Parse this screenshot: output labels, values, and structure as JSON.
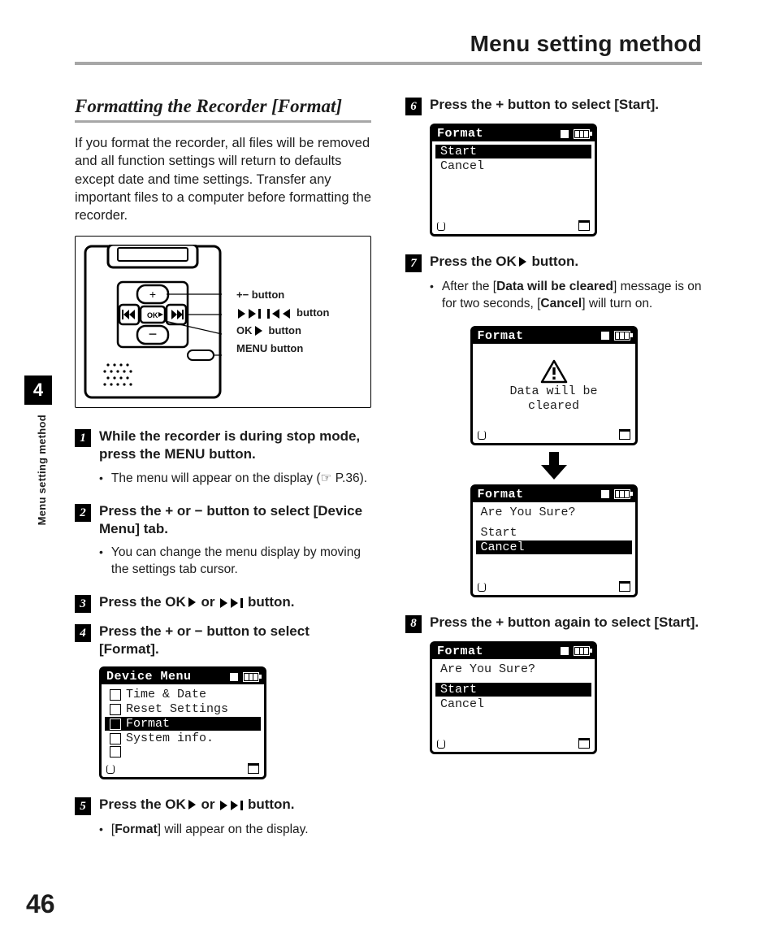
{
  "header": {
    "title": "Menu setting method"
  },
  "side": {
    "chapter": "4",
    "label": "Menu setting method"
  },
  "pagenum": "46",
  "section_title": "Formatting the Recorder [Format]",
  "intro": "If you format the recorder, all files will be removed and all function settings will return to defaults except date and time settings. Transfer any important files to a computer before formatting the recorder.",
  "legend": {
    "pm": "+− button",
    "skip": " button",
    "ok": " button",
    "menu": "MENU button"
  },
  "steps": {
    "s1": {
      "n": "1",
      "text_a": "While the recorder is during stop mode, press the ",
      "text_b": "MENU",
      "text_c": " button."
    },
    "s1_sub": "The menu will appear on the display (☞ P.36).",
    "s2": {
      "n": "2",
      "text_a": "Press the ",
      "text_b": "+",
      "text_c": " or ",
      "text_d": "−",
      "text_e": " button to select [",
      "text_f": "Device Menu",
      "text_g": "] tab."
    },
    "s2_sub": "You can change the menu display by moving the settings tab cursor.",
    "s3": {
      "n": "3",
      "text_a": "Press the ",
      "text_b": "OK",
      "text_c": " or ",
      "text_d": " button."
    },
    "s4": {
      "n": "4",
      "text_a": "Press the ",
      "text_b": "+",
      "text_c": " or ",
      "text_d": "−",
      "text_e": " button to select [",
      "text_f": "Format",
      "text_g": "]."
    },
    "s5": {
      "n": "5",
      "text_a": "Press the ",
      "text_b": "OK",
      "text_c": " or ",
      "text_d": " button."
    },
    "s5_sub_a": "[",
    "s5_sub_b": "Format",
    "s5_sub_c": "] will appear on the display.",
    "s6": {
      "n": "6",
      "text_a": "Press the ",
      "text_b": "+",
      "text_c": " button to select [",
      "text_d": "Start",
      "text_e": "]."
    },
    "s7": {
      "n": "7",
      "text_a": "Press the ",
      "text_b": "OK",
      "text_c": " button."
    },
    "s7_sub_a": "After the [",
    "s7_sub_b": "Data will be cleared",
    "s7_sub_c": "] message is on for two seconds, [",
    "s7_sub_d": "Cancel",
    "s7_sub_e": "] will turn on.",
    "s8": {
      "n": "8",
      "text_a": "Press the ",
      "text_b": "+",
      "text_c": " button again to select [",
      "text_d": "Start",
      "text_e": "]."
    }
  },
  "lcd": {
    "devmenu": {
      "title": "Device Menu",
      "items": [
        "Time & Date",
        "Reset Settings",
        "Format",
        "System info."
      ],
      "highlight_index": 2
    },
    "start1": {
      "title": "Format",
      "items": [
        "Start",
        "Cancel"
      ],
      "highlight_index": 0
    },
    "warn": {
      "title": "Format",
      "line1": "Data will be",
      "line2": "cleared"
    },
    "sure_cancel": {
      "title": "Format",
      "prompt": "Are You Sure?",
      "items": [
        "Start",
        "Cancel"
      ],
      "highlight_index": 1
    },
    "sure_start": {
      "title": "Format",
      "prompt": "Are You Sure?",
      "items": [
        "Start",
        "Cancel"
      ],
      "highlight_index": 0
    }
  }
}
